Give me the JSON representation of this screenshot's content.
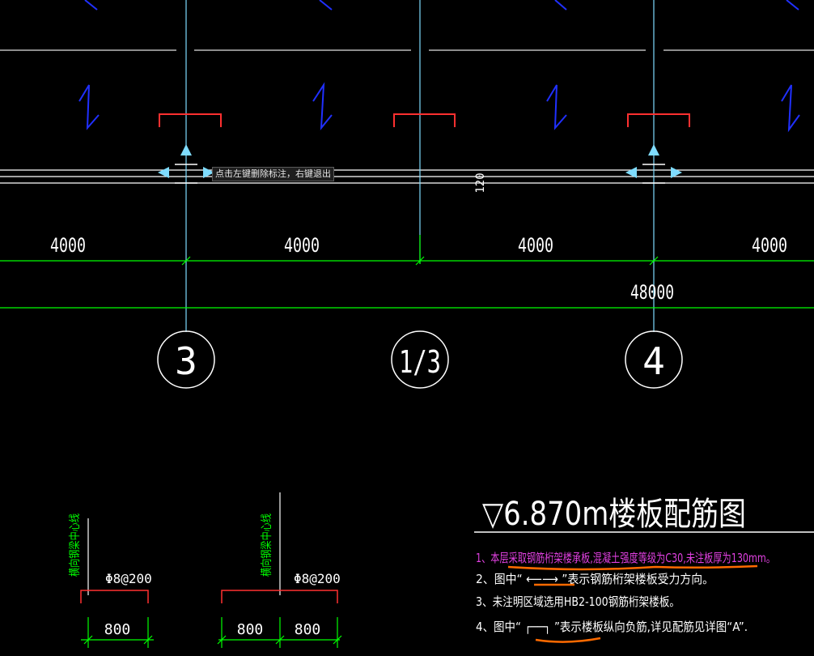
{
  "tooltip": {
    "text": "点击左键删除标注，右键退出"
  },
  "dimensions": {
    "spans": [
      "4000",
      "4000",
      "4000",
      "4000"
    ],
    "total": "48000",
    "thickness": "120"
  },
  "axes": [
    {
      "label": "3"
    },
    {
      "label": "1/3"
    },
    {
      "label": "4"
    }
  ],
  "title": {
    "text": "▽6.870m楼板配筋图"
  },
  "notes": [
    {
      "text": "1、本层采取钢筋桁架楼承板,混凝土强度等级为C30,未注板厚为130mm。",
      "color": "#e040e0"
    },
    {
      "text": "2、图中“ ⟵⟶ ”表示钢筋桁架楼板受力方向。",
      "color": "#ffffff"
    },
    {
      "text": "3、未注明区域选用HB2-100钢筋桁架楼板。",
      "color": "#ffffff"
    },
    {
      "text": "4、图中“ ┌──┐ ”表示楼板纵向负筋,详见配筋见详图“A”.",
      "color": "#ffffff"
    }
  ],
  "details": [
    {
      "beam_label": "横向钢梁中心线",
      "rebar": "Φ8@200",
      "dims": [
        "800"
      ]
    },
    {
      "beam_label": "横向钢梁中心线",
      "rebar": "Φ8@200",
      "dims": [
        "800",
        "800"
      ]
    }
  ],
  "colors": {
    "axis_line": "#7fdcff",
    "dimension": "#00ff00",
    "rebar": "#ff3030",
    "slab_dir": "#2030ff",
    "highlight": "#ff6a00",
    "note_magenta": "#e040e0"
  }
}
